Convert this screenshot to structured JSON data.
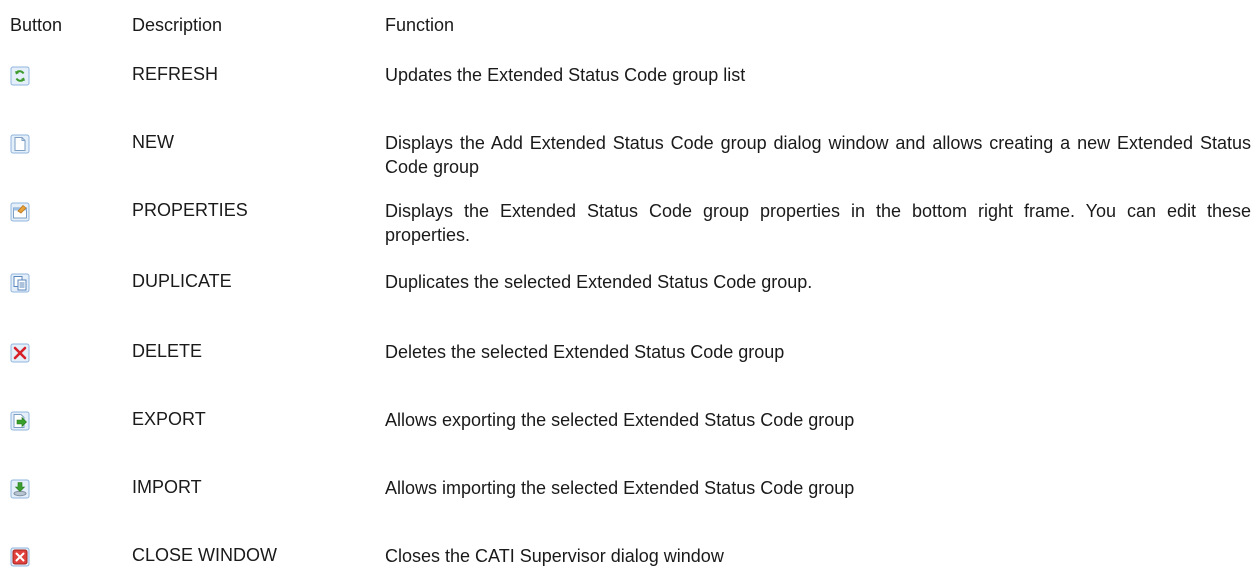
{
  "header": {
    "button": "Button",
    "description": "Description",
    "function": "Function"
  },
  "rows": [
    {
      "icon": "refresh-icon",
      "description": "REFRESH",
      "function": "Updates the Extended Status Code group list"
    },
    {
      "icon": "new-document-icon",
      "description": "NEW",
      "function": "Displays the Add Extended Status Code group dialog window and allows creating a new Extended Status Code group"
    },
    {
      "icon": "properties-icon",
      "description": "PROPERTIES",
      "function": "Displays the Extended Status Code group properties in the bottom right frame. You can edit these properties."
    },
    {
      "icon": "duplicate-icon",
      "description": "DUPLICATE",
      "function": "Duplicates the selected Extended Status Code group."
    },
    {
      "icon": "delete-icon",
      "description": "DELETE",
      "function": "Deletes the selected Extended Status Code group"
    },
    {
      "icon": "export-icon",
      "description": "EXPORT",
      "function": "Allows exporting the selected Extended Status Code group"
    },
    {
      "icon": "import-icon",
      "description": "IMPORT",
      "function": "Allows importing the selected Extended Status Code group"
    },
    {
      "icon": "close-window-icon",
      "description": "CLOSE WINDOW",
      "function": "Closes the CATI Supervisor dialog window"
    }
  ],
  "colors": {
    "text": "#1a1a1a",
    "icon_frame": "#8fb4dc",
    "icon_fill": "#e4effa",
    "refresh_green": "#3a9a2a",
    "delete_red": "#d8202a",
    "export_green": "#3aa02c",
    "import_green": "#3c9e30",
    "close_red": "#e0413d",
    "properties_orange": "#e8a23a"
  }
}
